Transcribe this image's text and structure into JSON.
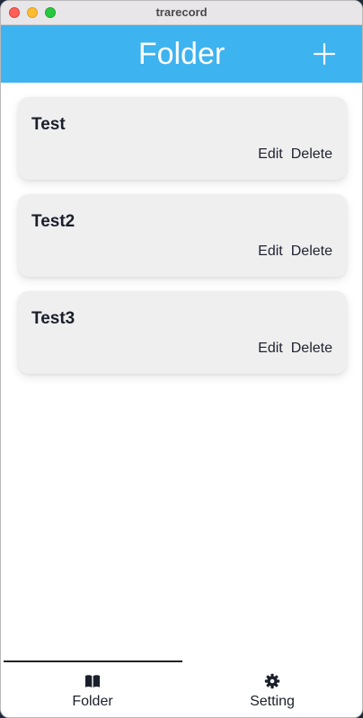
{
  "window": {
    "title": "trarecord"
  },
  "header": {
    "title": "Folder",
    "add_icon": "plus-icon"
  },
  "folders": [
    {
      "name": "Test",
      "edit_label": "Edit",
      "delete_label": "Delete"
    },
    {
      "name": "Test2",
      "edit_label": "Edit",
      "delete_label": "Delete"
    },
    {
      "name": "Test3",
      "edit_label": "Edit",
      "delete_label": "Delete"
    }
  ],
  "bottom_nav": {
    "items": [
      {
        "label": "Folder",
        "icon": "book-icon",
        "active": true
      },
      {
        "label": "Setting",
        "icon": "gear-icon",
        "active": false
      }
    ]
  },
  "colors": {
    "header": "#3db3ef",
    "card": "#efefef",
    "text": "#1a1f2b"
  }
}
